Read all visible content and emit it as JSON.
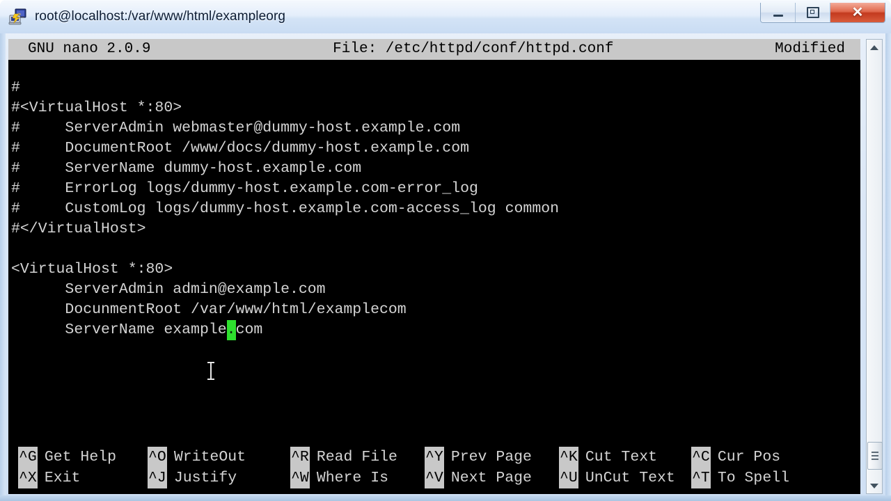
{
  "window": {
    "title": "root@localhost:/var/www/html/exampleorg",
    "icon": "putty-terminal-icon",
    "controls": {
      "minimize": "–",
      "maximize": "❐",
      "close": "✕"
    },
    "accent_titlebar": "#d3e3f6",
    "accent_close": "#c33a1f"
  },
  "nano": {
    "version_label": "GNU nano 2.0.9",
    "file_label": "File: /etc/httpd/conf/httpd.conf",
    "status_label": "Modified",
    "header_bg": "#c8c8c8",
    "header_fg": "#000000",
    "terminal_bg": "#000000",
    "terminal_fg": "#d4d4d4",
    "cursor_color": "#2ee02e"
  },
  "editor": {
    "lines": [
      "#",
      "#<VirtualHost *:80>",
      "#     ServerAdmin webmaster@dummy-host.example.com",
      "#     DocumentRoot /www/docs/dummy-host.example.com",
      "#     ServerName dummy-host.example.com",
      "#     ErrorLog logs/dummy-host.example.com-error_log",
      "#     CustomLog logs/dummy-host.example.com-access_log common",
      "#</VirtualHost>",
      "",
      "<VirtualHost *:80>",
      "      ServerAdmin admin@example.com",
      "      DocunmentRoot /var/www/html/examplecom"
    ],
    "cursor_line": {
      "before": "      ServerName example",
      "cursor_char": ".",
      "after": "com"
    },
    "mouse_pointer": "i-beam-text-cursor"
  },
  "shortcuts": {
    "row1": [
      {
        "key": "^G",
        "label": "Get Help"
      },
      {
        "key": "^O",
        "label": "WriteOut"
      },
      {
        "key": "^R",
        "label": "Read File"
      },
      {
        "key": "^Y",
        "label": "Prev Page"
      },
      {
        "key": "^K",
        "label": "Cut Text"
      },
      {
        "key": "^C",
        "label": "Cur Pos"
      }
    ],
    "row2": [
      {
        "key": "^X",
        "label": "Exit"
      },
      {
        "key": "^J",
        "label": "Justify"
      },
      {
        "key": "^W",
        "label": "Where Is"
      },
      {
        "key": "^V",
        "label": "Next Page"
      },
      {
        "key": "^U",
        "label": "UnCut Text"
      },
      {
        "key": "^T",
        "label": "To Spell"
      }
    ]
  },
  "scrollbar": {
    "up_arrow": "scroll-up-arrow",
    "down_arrow": "scroll-down-arrow",
    "thumb": "scroll-thumb"
  }
}
